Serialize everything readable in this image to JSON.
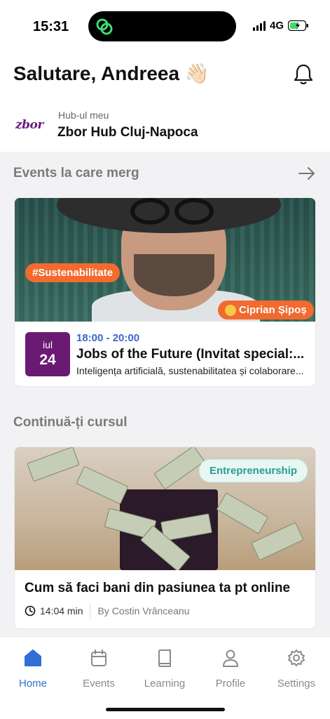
{
  "status": {
    "time": "15:31",
    "network": "4G"
  },
  "header": {
    "greeting": "Salutare, Andreea 👋🏻",
    "hub_caption": "Hub-ul meu",
    "hub_name": "Zbor Hub Cluj-Napoca",
    "hub_logo": "zbor"
  },
  "events": {
    "section_title": "Events la care merg",
    "card": {
      "topic_tag": "#Sustenabilitate",
      "speaker": "Ciprian Șipoș",
      "month": "iul",
      "day": "24",
      "time": "18:00 - 20:00",
      "title": "Jobs of the Future (Invitat special:...",
      "description": "Inteligența artificială, sustenabilitatea și colaborare..."
    }
  },
  "course": {
    "section_title": "Continuă-ți cursul",
    "card": {
      "tag": "Entrepreneurship",
      "title": "Cum să faci bani din pasiunea ta pt online",
      "duration": "14:04 min",
      "author": "By Costin Vrânceanu"
    }
  },
  "tabs": [
    {
      "label": "Home",
      "icon": "home-icon",
      "active": true
    },
    {
      "label": "Events",
      "icon": "calendar-icon",
      "active": false
    },
    {
      "label": "Learning",
      "icon": "book-icon",
      "active": false
    },
    {
      "label": "Profile",
      "icon": "profile-icon",
      "active": false
    },
    {
      "label": "Settings",
      "icon": "gear-icon",
      "active": false
    }
  ],
  "colors": {
    "accent": "#2f6fd6",
    "brand_purple": "#6b1a73",
    "tag_orange": "#f26a2e",
    "tag_teal": "#2a9d8f",
    "island_icon": "#3ddc6e"
  }
}
